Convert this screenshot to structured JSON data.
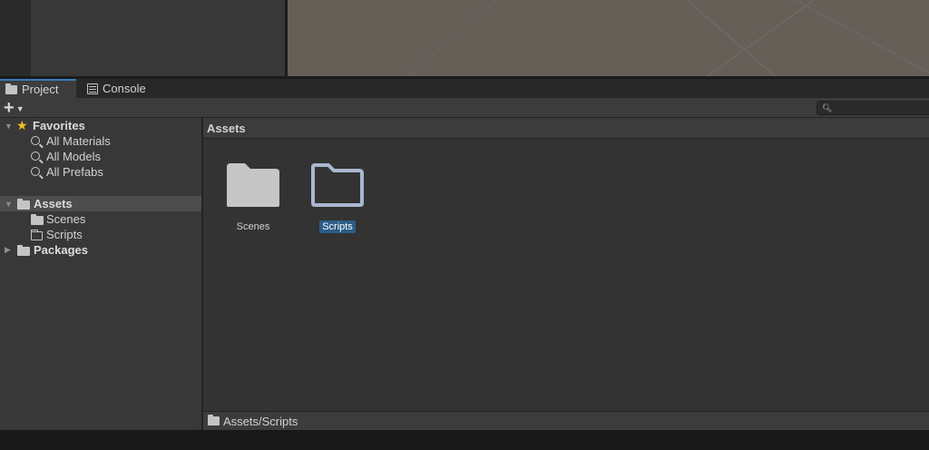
{
  "tabs": [
    {
      "label": "Project",
      "icon": "folder-icon",
      "active": true
    },
    {
      "label": "Console",
      "icon": "console-icon",
      "active": false
    }
  ],
  "toolbar": {
    "create_label": "+",
    "search_placeholder": ""
  },
  "tree": {
    "favorites": {
      "label": "Favorites",
      "items": [
        "All Materials",
        "All Models",
        "All Prefabs"
      ]
    },
    "assets": {
      "label": "Assets",
      "children": [
        "Scenes",
        "Scripts"
      ]
    },
    "packages": {
      "label": "Packages"
    }
  },
  "content": {
    "header": "Assets",
    "items": [
      {
        "label": "Scenes",
        "icon": "folder-filled-icon",
        "selected": false
      },
      {
        "label": "Scripts",
        "icon": "folder-outline-icon",
        "selected": true
      }
    ]
  },
  "footer": {
    "path": "Assets/Scripts"
  },
  "colors": {
    "selection": "#2c5d87",
    "favorite_star": "#f2c31f",
    "scene_background": "#665f58",
    "selected_folder": "#a9b8cf"
  }
}
